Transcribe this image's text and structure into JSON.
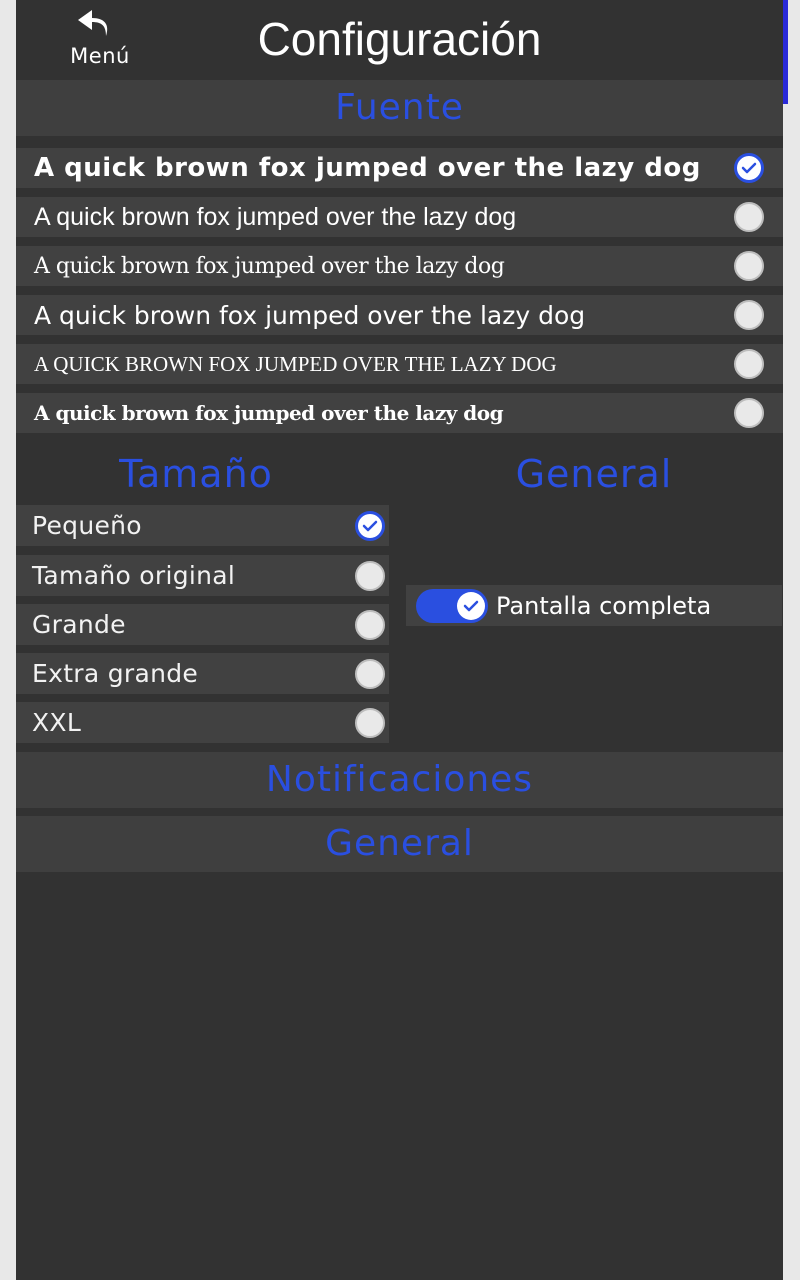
{
  "header": {
    "back_label": "Menú",
    "title": "Configuración"
  },
  "sections": {
    "font": "Fuente",
    "size": "Tamaño",
    "general_col": "General",
    "notifications": "Notificaciones",
    "general": "General"
  },
  "font_options": [
    {
      "sample": "A quick brown fox jumped over the lazy dog",
      "selected": true
    },
    {
      "sample": "A quick brown fox jumped over the lazy dog",
      "selected": false
    },
    {
      "sample": "A quick brown fox jumped over the lazy dog",
      "selected": false
    },
    {
      "sample": "A quick brown fox jumped over the lazy dog",
      "selected": false
    },
    {
      "sample": "A QUICK BROWN FOX JUMPED OVER THE LAZY DOG",
      "selected": false
    },
    {
      "sample": "A quick brown fox jumped over the lazy dog",
      "selected": false
    }
  ],
  "size_options": [
    {
      "label": "Pequeño",
      "selected": true
    },
    {
      "label": "Tamaño original",
      "selected": false
    },
    {
      "label": "Grande",
      "selected": false
    },
    {
      "label": "Extra grande",
      "selected": false
    },
    {
      "label": "XXL",
      "selected": false
    }
  ],
  "general_options": {
    "fullscreen_label": "Pantalla completa",
    "fullscreen_on": true
  },
  "colors": {
    "accent": "#2a4fe0",
    "panel": "#323232",
    "row": "#414141",
    "outer": "#e8e8e8"
  },
  "icons": {
    "back": "back-arrow-icon",
    "check": "check-icon"
  }
}
